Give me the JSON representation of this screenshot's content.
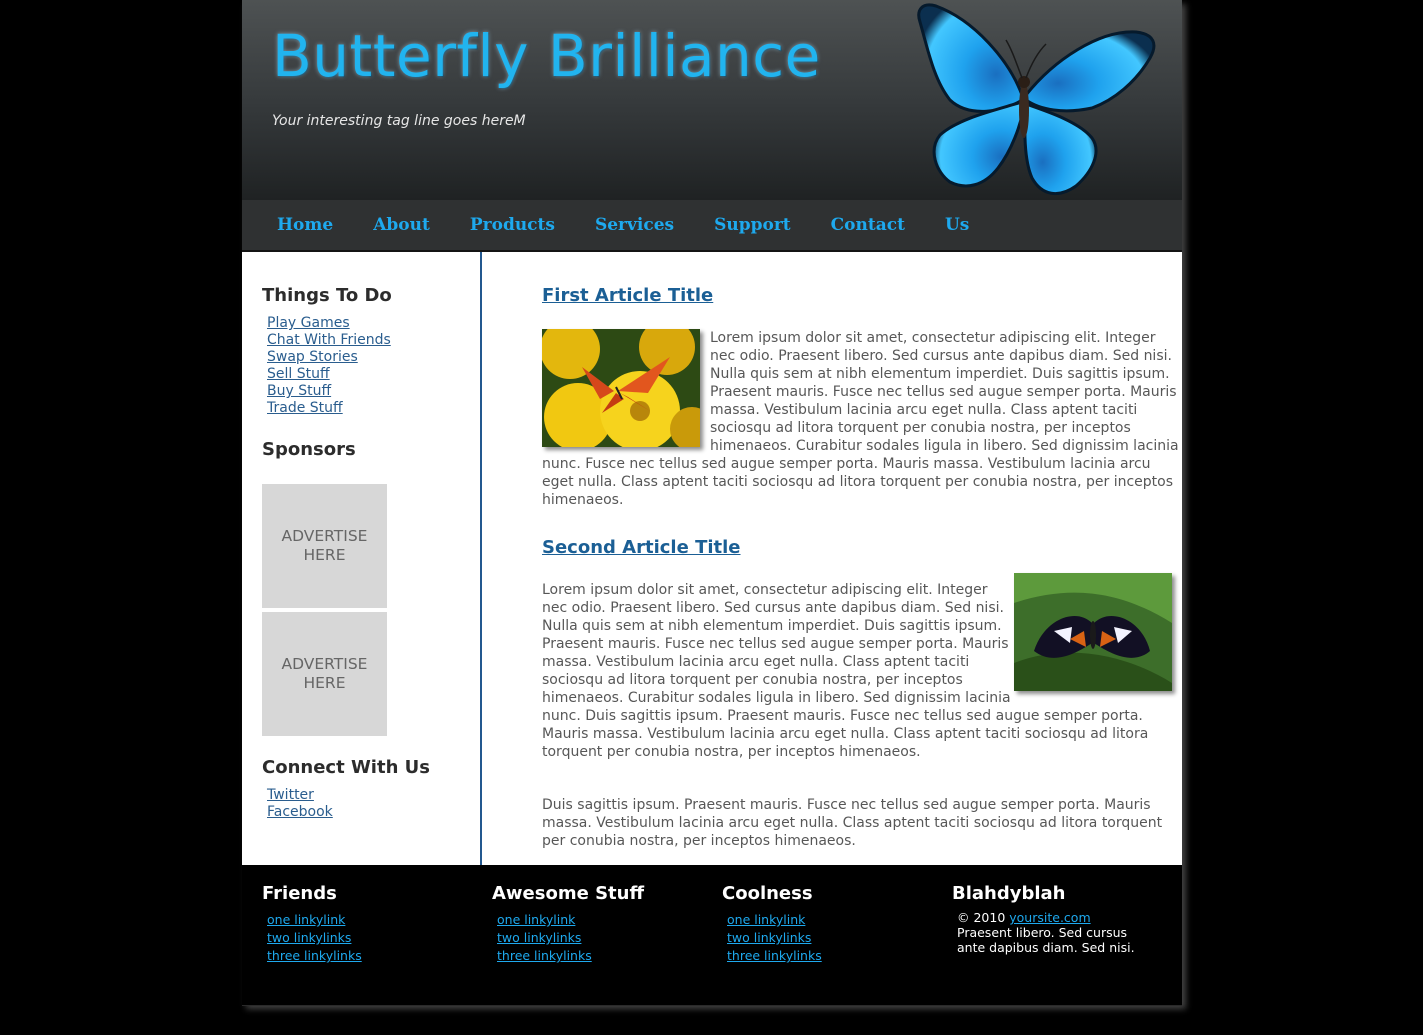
{
  "header": {
    "site_title": "Butterfly Brilliance",
    "tagline": "Your interesting tag line goes hereM"
  },
  "nav": {
    "items": [
      {
        "label": "Home"
      },
      {
        "label": "About"
      },
      {
        "label": "Products"
      },
      {
        "label": "Services"
      },
      {
        "label": "Support"
      },
      {
        "label": "Contact"
      },
      {
        "label": "Us"
      }
    ]
  },
  "sidebar": {
    "things_heading": "Things To Do",
    "things_links": [
      "Play Games",
      "Chat With Friends",
      "Swap Stories",
      "Sell Stuff",
      "Buy Stuff",
      "Trade Stuff"
    ],
    "sponsors_heading": "Sponsors",
    "ads": [
      {
        "line1": "ADVERTISE",
        "line2": "HERE"
      },
      {
        "line1": "ADVERTISE",
        "line2": "HERE"
      }
    ],
    "connect_heading": "Connect With Us",
    "connect_links": [
      "Twitter",
      "Facebook"
    ]
  },
  "articles": [
    {
      "title": "First Article Title",
      "body": "Lorem ipsum dolor sit amet, consectetur adipiscing elit. Integer nec odio. Praesent libero. Sed cursus ante dapibus diam. Sed nisi. Nulla quis sem at nibh elementum imperdiet. Duis sagittis ipsum. Praesent mauris. Fusce nec tellus sed augue semper porta. Mauris massa. Vestibulum lacinia arcu eget nulla. Class aptent taciti sociosqu ad litora torquent per conubia nostra, per inceptos himenaeos. Curabitur sodales ligula in libero. Sed dignissim lacinia nunc. Fusce nec tellus sed augue semper porta. Mauris massa. Vestibulum lacinia arcu eget nulla. Class aptent taciti sociosqu ad litora torquent per conubia nostra, per inceptos himenaeos."
    },
    {
      "title": "Second Article Title",
      "body": "Lorem ipsum dolor sit amet, consectetur adipiscing elit. Integer nec odio. Praesent libero. Sed cursus ante dapibus diam. Sed nisi. Nulla quis sem at nibh elementum imperdiet. Duis sagittis ipsum. Praesent mauris. Fusce nec tellus sed augue semper porta. Mauris massa. Vestibulum lacinia arcu eget nulla. Class aptent taciti sociosqu ad litora torquent per conubia nostra, per inceptos himenaeos. Curabitur sodales ligula in libero. Sed dignissim lacinia nunc. Duis sagittis ipsum. Praesent mauris. Fusce nec tellus sed augue semper porta. Mauris massa. Vestibulum lacinia arcu eget nulla. Class aptent taciti sociosqu ad litora torquent per conubia nostra, per inceptos himenaeos.",
      "body2": "Duis sagittis ipsum. Praesent mauris. Fusce nec tellus sed augue semper porta. Mauris massa. Vestibulum lacinia arcu eget nulla. Class aptent taciti sociosqu ad litora torquent per conubia nostra, per inceptos himenaeos."
    }
  ],
  "footer": {
    "columns": [
      {
        "heading": "Friends",
        "links": [
          "one linkylink",
          "two linkylinks",
          "three linkylinks"
        ]
      },
      {
        "heading": "Awesome Stuff",
        "links": [
          "one linkylink",
          "two linkylinks",
          "three linkylinks"
        ]
      },
      {
        "heading": "Coolness",
        "links": [
          "one linkylink",
          "two linkylinks",
          "three linkylinks"
        ]
      }
    ],
    "blah": {
      "heading": "Blahdyblah",
      "copyright": "© 2010 ",
      "site_link": "yoursite.com",
      "text": "Praesent libero. Sed cursus ante dapibus diam. Sed nisi."
    }
  },
  "colors": {
    "accent_blue": "#1ea9ee",
    "link_blue": "#2a5d8e",
    "article_title": "#1b5f95",
    "nav_bg": "#2f3132",
    "footer_bg": "#000000"
  },
  "icons": {
    "hero": "blue-morpho-butterfly-icon",
    "thumb1": "orange-butterfly-on-yellow-flowers-icon",
    "thumb2": "black-orange-butterfly-on-leaf-icon"
  }
}
